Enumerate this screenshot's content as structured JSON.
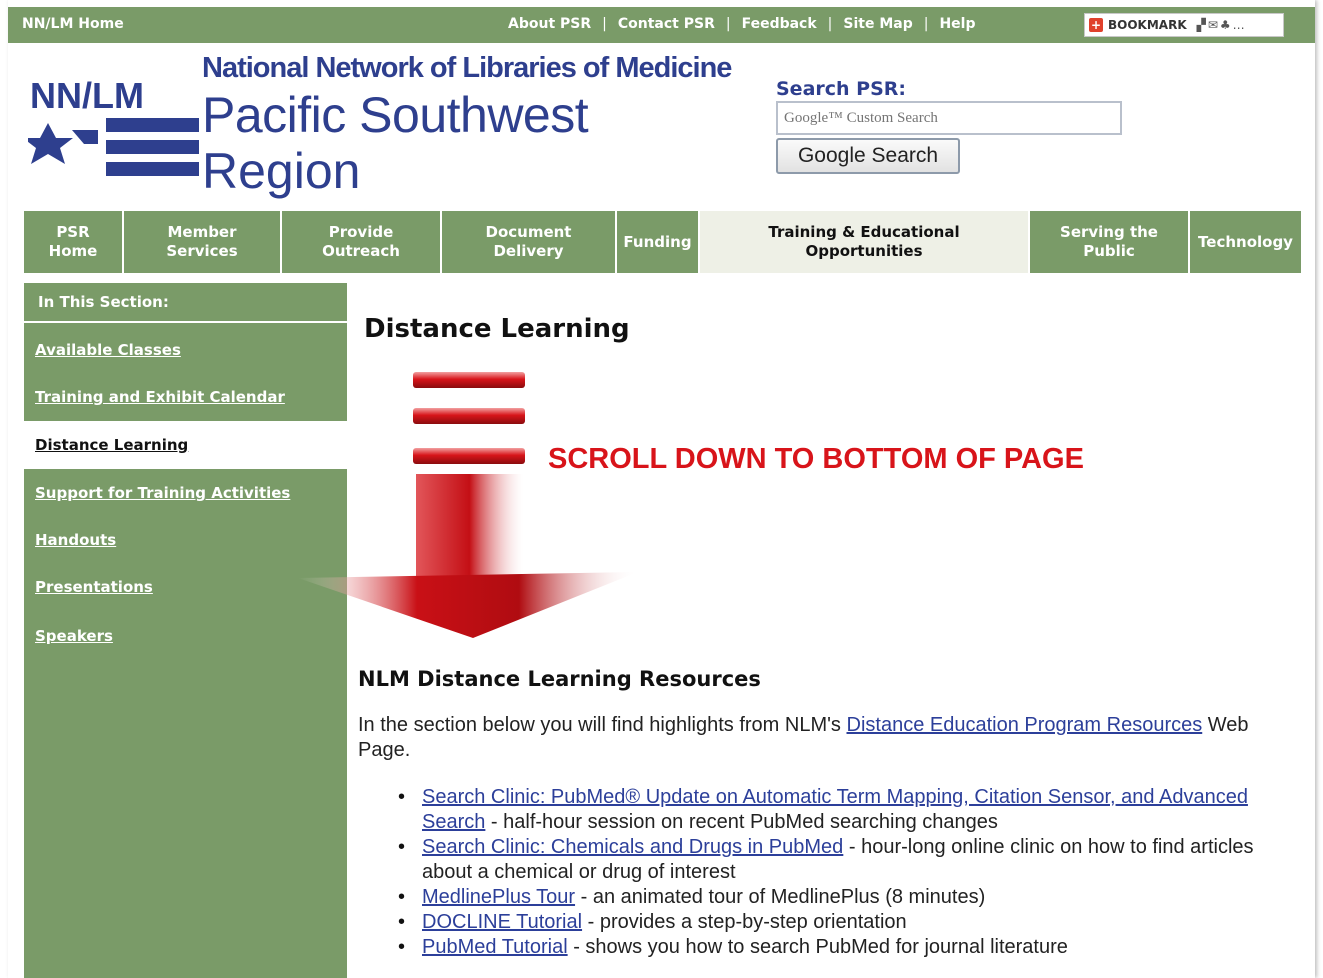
{
  "topbar": {
    "home": "NN/LM Home",
    "links": [
      "About PSR",
      "Contact PSR",
      "Feedback",
      "Site Map",
      "Help"
    ],
    "bookmark_label": "BOOKMARK"
  },
  "header": {
    "logo_text": "NN/LM",
    "org_name": "National Network of Libraries of Medicine",
    "region_line1": "Pacific Southwest",
    "region_line2": "Region"
  },
  "search": {
    "label": "Search PSR:",
    "placeholder": "Google™ Custom Search",
    "button": "Google Search"
  },
  "nav": {
    "tabs": [
      {
        "line1": "PSR",
        "line2": "Home"
      },
      {
        "line1": "Member",
        "line2": "Services"
      },
      {
        "line1": "Provide",
        "line2": "Outreach"
      },
      {
        "line1": "Document",
        "line2": "Delivery"
      },
      {
        "line1": "Funding",
        "line2": ""
      },
      {
        "line1": "Training & Educational",
        "line2": "Opportunities"
      },
      {
        "line1": "Serving the",
        "line2": "Public"
      },
      {
        "line1": "Technology",
        "line2": ""
      }
    ]
  },
  "sidebar": {
    "heading": "In This Section:",
    "items": [
      "Available Classes",
      "Training and Exhibit Calendar",
      "Distance Learning",
      "Support for Training Activities",
      "Handouts",
      "Presentations",
      "Speakers"
    ]
  },
  "main": {
    "title": "Distance Learning",
    "scroll_note": "SCROLL DOWN TO BOTTOM OF PAGE",
    "section_heading": "NLM Distance Learning Resources",
    "intro_before": "In the section below you will find highlights from NLM's ",
    "intro_link": "Distance Education Program Resources",
    "intro_after": " Web Page.",
    "resources": [
      {
        "link": "Search Clinic: PubMed® Update on Automatic Term Mapping, Citation Sensor, and Advanced Search",
        "desc": " - half-hour session on recent PubMed searching changes"
      },
      {
        "link": "Search Clinic: Chemicals and Drugs in PubMed",
        "desc": " - hour-long online clinic on how to find articles about a chemical or drug of interest"
      },
      {
        "link": "MedlinePlus Tour",
        "desc": " - an animated tour of MedlinePlus (8 minutes)"
      },
      {
        "link": "DOCLINE Tutorial",
        "desc": " - provides a step-by-step orientation"
      },
      {
        "link": "PubMed Tutorial",
        "desc": " - shows you how to search PubMed for journal literature"
      }
    ]
  },
  "colors": {
    "green": "#7a9b68",
    "navy": "#2e3f8e",
    "alert_red": "#d8141a",
    "link": "#2c3f9a"
  }
}
